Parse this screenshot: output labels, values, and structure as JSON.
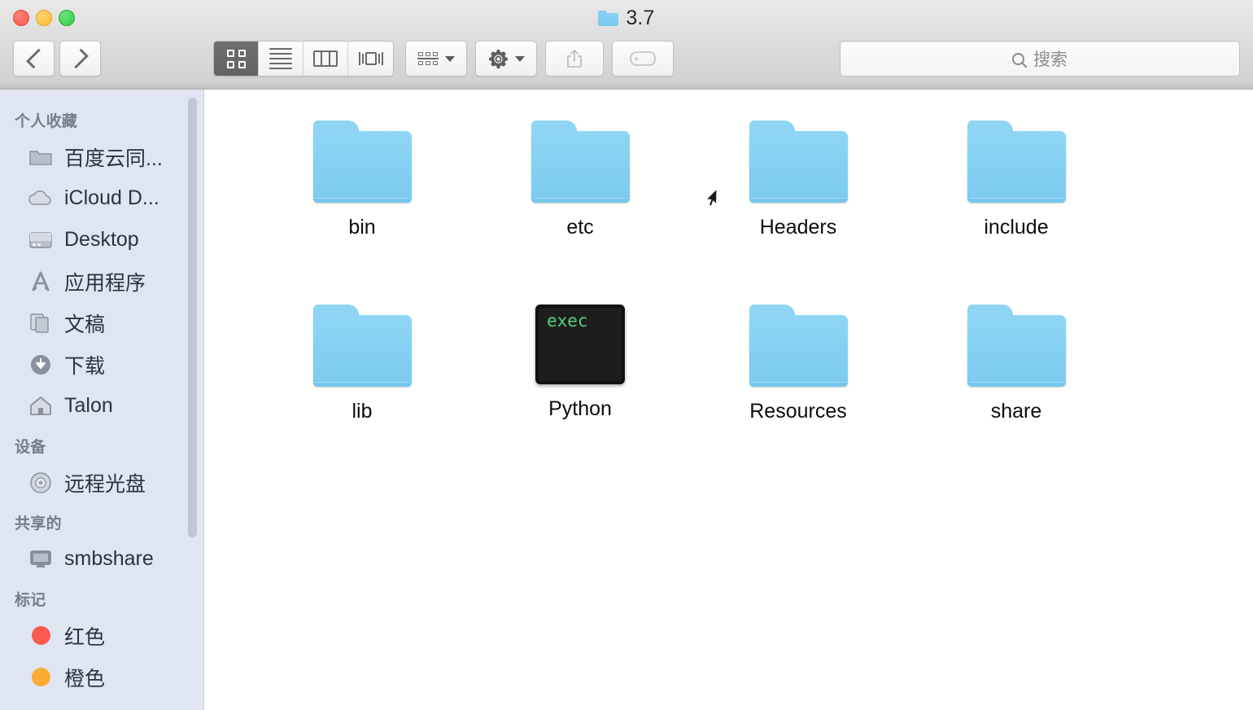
{
  "window": {
    "title": "3.7",
    "title_icon": "folder-icon",
    "traffic_lights": [
      {
        "name": "close",
        "color": "#f9564c"
      },
      {
        "name": "minimize",
        "color": "#fcbc2c"
      },
      {
        "name": "maximize",
        "color": "#2bc940"
      }
    ]
  },
  "toolbar": {
    "back_icon": "chevron-left-icon",
    "forward_icon": "chevron-right-icon",
    "views": [
      {
        "name": "icon-view",
        "icon": "grid-icon",
        "active": true
      },
      {
        "name": "list-view",
        "icon": "list-icon",
        "active": false
      },
      {
        "name": "column-view",
        "icon": "columns-icon",
        "active": false
      },
      {
        "name": "coverflow-view",
        "icon": "coverflow-icon",
        "active": false
      }
    ],
    "arrange": {
      "name": "arrange-button",
      "icon": "arrange-icon",
      "caret": "chevron-down-icon"
    },
    "action": {
      "name": "action-button",
      "icon": "gear-icon",
      "caret": "chevron-down-icon"
    },
    "share": {
      "name": "share-button",
      "icon": "share-icon",
      "enabled": false
    },
    "tags": {
      "name": "tags-button",
      "icon": "tag-icon",
      "enabled": false
    }
  },
  "search": {
    "icon": "search-icon",
    "placeholder": "搜索",
    "value": ""
  },
  "sidebar": {
    "sections": [
      {
        "header": "个人收藏",
        "items": [
          {
            "label": "百度云同...",
            "icon": "folder-icon"
          },
          {
            "label": "iCloud D...",
            "icon": "cloud-icon"
          },
          {
            "label": "Desktop",
            "icon": "desktop-icon"
          },
          {
            "label": "应用程序",
            "icon": "applications-icon"
          },
          {
            "label": "文稿",
            "icon": "documents-icon"
          },
          {
            "label": "下载",
            "icon": "downloads-icon"
          },
          {
            "label": "Talon",
            "icon": "home-icon"
          }
        ]
      },
      {
        "header": "设备",
        "items": [
          {
            "label": "远程光盘",
            "icon": "disc-icon"
          }
        ]
      },
      {
        "header": "共享的",
        "items": [
          {
            "label": "smbshare",
            "icon": "display-icon"
          }
        ]
      },
      {
        "header": "标记",
        "items": [
          {
            "label": "红色",
            "icon": "tag-dot",
            "color": "#fb5a50"
          },
          {
            "label": "橙色",
            "icon": "tag-dot",
            "color": "#fbab34"
          }
        ]
      }
    ]
  },
  "files": [
    {
      "name": "bin",
      "kind": "folder"
    },
    {
      "name": "etc",
      "kind": "folder"
    },
    {
      "name": "Headers",
      "kind": "folder"
    },
    {
      "name": "include",
      "kind": "folder"
    },
    {
      "name": "lib",
      "kind": "folder"
    },
    {
      "name": "Python",
      "kind": "executable",
      "badge": "exec"
    },
    {
      "name": "Resources",
      "kind": "folder"
    },
    {
      "name": "share",
      "kind": "folder"
    }
  ]
}
